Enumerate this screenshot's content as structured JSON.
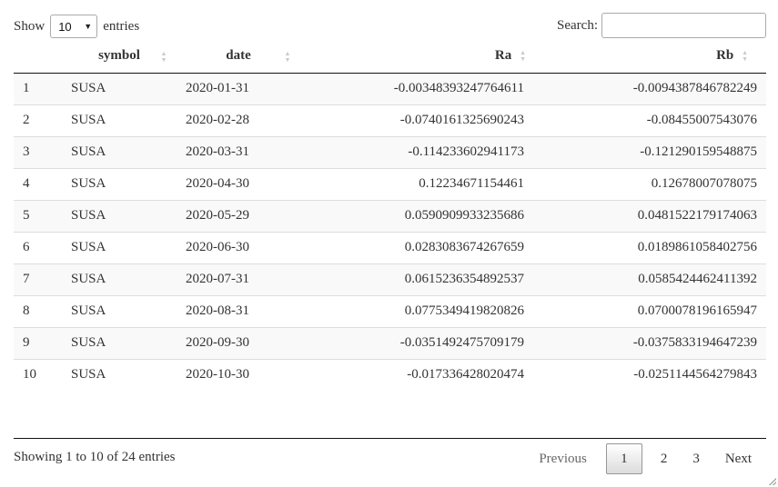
{
  "length": {
    "prefix": "Show",
    "selected": "10",
    "suffix": "entries"
  },
  "search": {
    "label": "Search:",
    "value": "",
    "placeholder": ""
  },
  "columns": [
    "",
    "symbol",
    "date",
    "Ra",
    "Rb"
  ],
  "rows": [
    {
      "idx": "1",
      "symbol": "SUSA",
      "date": "2020-01-31",
      "ra": "-0.00348393247764611",
      "rb": "-0.0094387846782249"
    },
    {
      "idx": "2",
      "symbol": "SUSA",
      "date": "2020-02-28",
      "ra": "-0.0740161325690243",
      "rb": "-0.08455007543076"
    },
    {
      "idx": "3",
      "symbol": "SUSA",
      "date": "2020-03-31",
      "ra": "-0.114233602941173",
      "rb": "-0.121290159548875"
    },
    {
      "idx": "4",
      "symbol": "SUSA",
      "date": "2020-04-30",
      "ra": "0.12234671154461",
      "rb": "0.12678007078075"
    },
    {
      "idx": "5",
      "symbol": "SUSA",
      "date": "2020-05-29",
      "ra": "0.0590909933235686",
      "rb": "0.0481522179174063"
    },
    {
      "idx": "6",
      "symbol": "SUSA",
      "date": "2020-06-30",
      "ra": "0.0283083674267659",
      "rb": "0.0189861058402756"
    },
    {
      "idx": "7",
      "symbol": "SUSA",
      "date": "2020-07-31",
      "ra": "0.0615236354892537",
      "rb": "0.0585424462411392"
    },
    {
      "idx": "8",
      "symbol": "SUSA",
      "date": "2020-08-31",
      "ra": "0.0775349419820826",
      "rb": "0.0700078196165947"
    },
    {
      "idx": "9",
      "symbol": "SUSA",
      "date": "2020-09-30",
      "ra": "-0.0351492475709179",
      "rb": "-0.0375833194647239"
    },
    {
      "idx": "10",
      "symbol": "SUSA",
      "date": "2020-10-30",
      "ra": "-0.017336428020474",
      "rb": "-0.0251144564279843"
    }
  ],
  "info": "Showing 1 to 10 of 24 entries",
  "pagination": {
    "previous": "Previous",
    "pages": [
      "1",
      "2",
      "3"
    ],
    "current": "1",
    "next": "Next"
  },
  "icons": {
    "sort": "sort-both-icon",
    "dropdown": "caret-down-icon",
    "resize": "resize-grip-icon"
  }
}
